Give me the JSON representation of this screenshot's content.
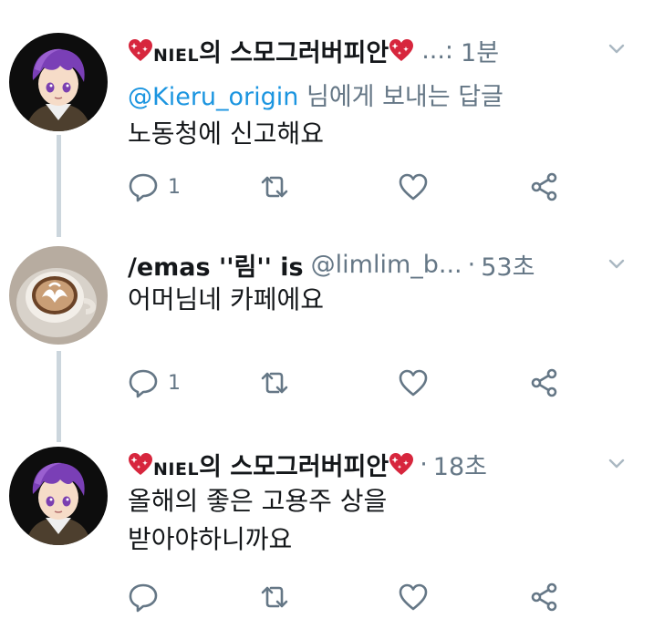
{
  "tweets": [
    {
      "display_name_niel": "NIEL",
      "display_name_rest": "의 스모그러버피안",
      "handle": "...:",
      "time": "1분",
      "reply_prefix": "",
      "reply_mention": "@Kieru_origin",
      "reply_suffix": " 님에게 보내는 답글",
      "text": "노동청에 신고해요",
      "reply_count": "1"
    },
    {
      "display_name": "/emas ''림'' is",
      "handle": "@limlim_b...",
      "time": "53초",
      "text": "어머님네 카페에요",
      "reply_count": "1"
    },
    {
      "display_name_niel": "NIEL",
      "display_name_rest": "의 스모그러버피안",
      "time": "18초",
      "text_line1": "올해의 좋은 고용주 상을",
      "text_line2": "받아야하니까요",
      "reply_count": ""
    }
  ],
  "icons": {
    "reply": "reply-icon",
    "retweet": "retweet-icon",
    "like": "heart-icon",
    "share": "share-icon",
    "more": "chevron-down-icon",
    "emoji": "sparkling-heart-icon"
  },
  "colors": {
    "secondary_text": "#657786",
    "link": "#1b95e0",
    "thread_line": "#ccd6dd",
    "emoji_heart": "#d7263d"
  }
}
